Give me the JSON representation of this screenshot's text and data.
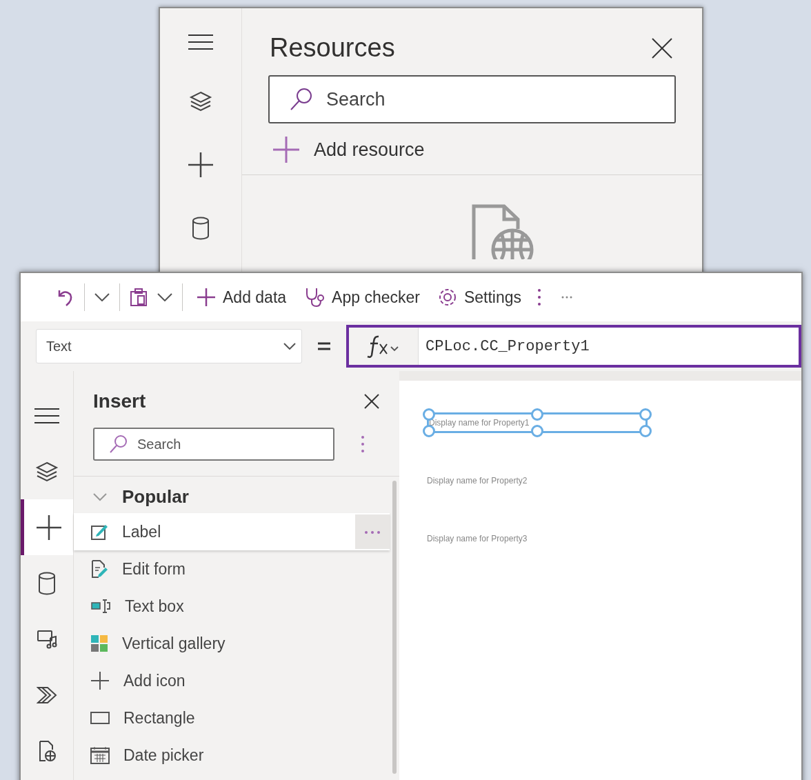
{
  "resources_panel": {
    "rail": [
      {
        "kind": "menu"
      },
      {
        "kind": "layers"
      },
      {
        "kind": "plus"
      },
      {
        "kind": "data"
      }
    ],
    "title": "Resources",
    "search": {
      "placeholder": "Search"
    },
    "add_button": "Add resource"
  },
  "toolbar": {
    "items": [
      {
        "kind": "undo"
      },
      {
        "kind": "caret"
      },
      {
        "kind": "paste"
      },
      {
        "kind": "caret"
      },
      {
        "kind": "add",
        "label": "Add data"
      },
      {
        "kind": "checker",
        "label": "App checker"
      },
      {
        "kind": "settings",
        "label": "Settings"
      },
      {
        "kind": "more"
      }
    ]
  },
  "formula_bar": {
    "property": "Text",
    "formula": "CPLoc.CC_Property1"
  },
  "rail": [
    {
      "kind": "menu",
      "selected": false
    },
    {
      "kind": "layers",
      "selected": false
    },
    {
      "kind": "plus",
      "selected": true
    },
    {
      "kind": "data",
      "selected": false
    },
    {
      "kind": "media",
      "selected": false
    },
    {
      "kind": "automate",
      "selected": false
    },
    {
      "kind": "variables",
      "selected": false
    }
  ],
  "insert_panel": {
    "title": "Insert",
    "search": {
      "placeholder": "Search"
    },
    "group": {
      "label": "Popular",
      "expanded": true,
      "items": [
        {
          "kind": "label",
          "label": "Label",
          "selected": true
        },
        {
          "kind": "form",
          "label": "Edit form",
          "selected": false
        },
        {
          "kind": "textbox",
          "label": "Text box",
          "selected": false
        },
        {
          "kind": "gallery",
          "label": "Vertical gallery",
          "selected": false
        },
        {
          "kind": "icon",
          "label": "Add icon",
          "selected": false
        },
        {
          "kind": "rectangle",
          "label": "Rectangle",
          "selected": false
        },
        {
          "kind": "date",
          "label": "Date picker",
          "selected": false
        }
      ]
    }
  },
  "canvas": {
    "labels": [
      {
        "text": "Display name for Property1",
        "selected": true
      },
      {
        "text": "Display name for Property2",
        "selected": false
      },
      {
        "text": "Display name for Property3",
        "selected": false
      }
    ]
  }
}
